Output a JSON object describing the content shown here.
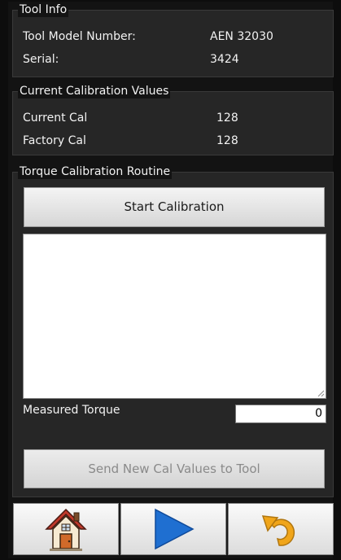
{
  "tool_info": {
    "title": "Tool Info",
    "model_label": "Tool Model Number:",
    "model_value": "AEN 32030",
    "serial_label": "Serial:",
    "serial_value": "3424"
  },
  "calibration_values": {
    "title": "Current Calibration Values",
    "current_label": "Current Cal",
    "current_value": "128",
    "factory_label": "Factory Cal",
    "factory_value": "128"
  },
  "routine": {
    "title": "Torque Calibration Routine",
    "start_button": "Start Calibration",
    "log_text": "",
    "measured_label": "Measured Torque",
    "measured_value": "0",
    "send_button": "Send New Cal Values to Tool"
  },
  "toolbar": {
    "home_icon": "home-icon",
    "play_icon": "play-icon",
    "undo_icon": "undo-icon"
  },
  "colors": {
    "play": "#1f6fd1",
    "undo": "#f0a51a",
    "house_roof": "#c0392b",
    "house_door": "#d06a2a"
  }
}
